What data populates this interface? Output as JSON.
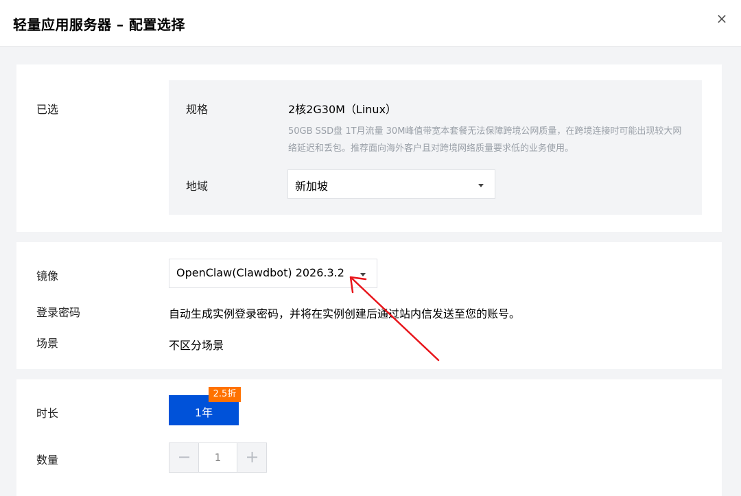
{
  "dialog": {
    "title": "轻量应用服务器 – 配置选择",
    "close_icon": "×"
  },
  "selected": {
    "label": "已选",
    "spec": {
      "label": "规格",
      "value": "2核2G30M（Linux）",
      "description": "50GB SSD盘 1T月流量 30M峰值带宽本套餐无法保障跨境公网质量，在跨境连接时可能出现较大网络延迟和丢包。推荐面向海外客户且对跨境网络质量要求低的业务使用。"
    },
    "region": {
      "label": "地域",
      "value": "新加坡"
    }
  },
  "image_section": {
    "image": {
      "label": "镜像",
      "value": "OpenClaw(Clawdbot) 2026.3.2"
    },
    "password": {
      "label": "登录密码",
      "value": "自动生成实例登录密码，并将在实例创建后通过站内信发送至您的账号。"
    },
    "scenario": {
      "label": "场景",
      "value": "不区分场景"
    }
  },
  "purchase": {
    "duration": {
      "label": "时长",
      "option": "1年",
      "badge": "2.5折"
    },
    "quantity": {
      "label": "数量",
      "value": "1",
      "minus": "−",
      "plus": "+"
    }
  },
  "colors": {
    "primary": "#0052d9",
    "badge": "#ff7200",
    "annotation_arrow": "#e8151b"
  }
}
